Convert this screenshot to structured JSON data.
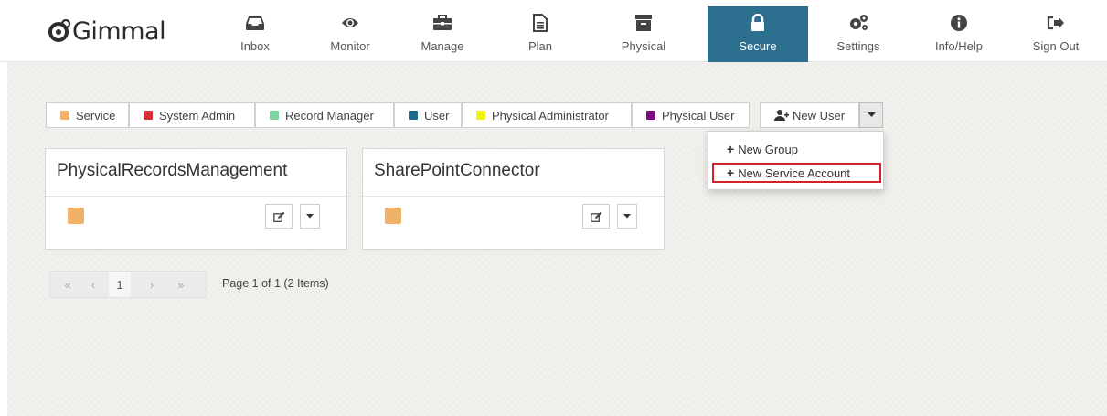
{
  "brand": {
    "name": "Gimmal"
  },
  "nav": [
    {
      "label": "Inbox",
      "icon": "inbox-icon"
    },
    {
      "label": "Monitor",
      "icon": "eye-icon"
    },
    {
      "label": "Manage",
      "icon": "briefcase-icon"
    },
    {
      "label": "Plan",
      "icon": "document-icon"
    },
    {
      "label": "Physical",
      "icon": "archive-box-icon"
    },
    {
      "label": "Secure",
      "icon": "lock-icon",
      "active": true
    },
    {
      "label": "Settings",
      "icon": "gears-icon"
    },
    {
      "label": "Info/Help",
      "icon": "info-icon"
    },
    {
      "label": "Sign Out",
      "icon": "sign-out-icon"
    }
  ],
  "legend": [
    {
      "label": "Service",
      "color": "#f0b26b"
    },
    {
      "label": "System Admin",
      "color": "#d62f35"
    },
    {
      "label": "Record Manager",
      "color": "#7fd3a0"
    },
    {
      "label": "User",
      "color": "#1f6b8c"
    },
    {
      "label": "Physical Administrator",
      "color": "#f2f20a"
    },
    {
      "label": "Physical User",
      "color": "#7d0a7d"
    }
  ],
  "new_user": {
    "label": "New User"
  },
  "dropdown": {
    "items": [
      {
        "label": "New Group"
      },
      {
        "label": "New Service Account",
        "highlighted": true
      }
    ]
  },
  "cards": [
    {
      "title": "PhysicalRecordsManagement",
      "type_color": "#f0b26b"
    },
    {
      "title": "SharePointConnector",
      "type_color": "#f0b26b"
    }
  ],
  "pager": {
    "first": "«",
    "prev": "‹",
    "current": "1",
    "next": "›",
    "last": "»",
    "info": "Page 1 of 1 (2 Items)"
  },
  "colors": {
    "active_nav": "#2c6f8f",
    "highlight_border": "#d3232a"
  }
}
